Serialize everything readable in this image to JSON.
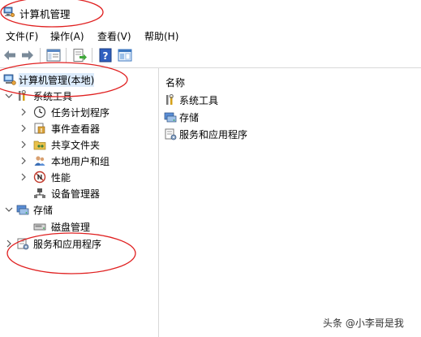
{
  "window": {
    "title": "计算机管理"
  },
  "menu": [
    {
      "label": "文件(F)"
    },
    {
      "label": "操作(A)"
    },
    {
      "label": "查看(V)"
    },
    {
      "label": "帮助(H)"
    }
  ],
  "toolbar": {
    "buttons": [
      {
        "icon": "back-arrow-icon"
      },
      {
        "icon": "forward-arrow-icon"
      },
      {
        "icon": "show-hide-tree-icon"
      },
      {
        "icon": "export-list-icon"
      },
      {
        "icon": "help-icon"
      },
      {
        "icon": "properties-icon"
      }
    ]
  },
  "tree": {
    "root": {
      "label": "计算机管理(本地)",
      "selected": true
    },
    "items": [
      {
        "label": "系统工具",
        "expanded": true,
        "icon": "tools-icon"
      },
      {
        "label": "任务计划程序",
        "icon": "clock-icon"
      },
      {
        "label": "事件查看器",
        "icon": "event-viewer-icon"
      },
      {
        "label": "共享文件夹",
        "icon": "shared-folder-icon"
      },
      {
        "label": "本地用户和组",
        "icon": "users-icon"
      },
      {
        "label": "性能",
        "icon": "performance-icon"
      },
      {
        "label": "设备管理器",
        "icon": "device-manager-icon"
      },
      {
        "label": "存储",
        "expanded": true,
        "icon": "storage-icon"
      },
      {
        "label": "磁盘管理",
        "icon": "disk-icon"
      },
      {
        "label": "服务和应用程序",
        "icon": "services-icon"
      }
    ]
  },
  "list": {
    "column_header": "名称",
    "items": [
      {
        "label": "系统工具",
        "icon": "tools-icon"
      },
      {
        "label": "存储",
        "icon": "storage-icon"
      },
      {
        "label": "服务和应用程序",
        "icon": "services-icon"
      }
    ]
  },
  "watermark": "头条 @小李哥是我",
  "colors": {
    "selection": "#dcebfb",
    "annotation_circle": "#e02020",
    "border": "#d9d9d9"
  }
}
